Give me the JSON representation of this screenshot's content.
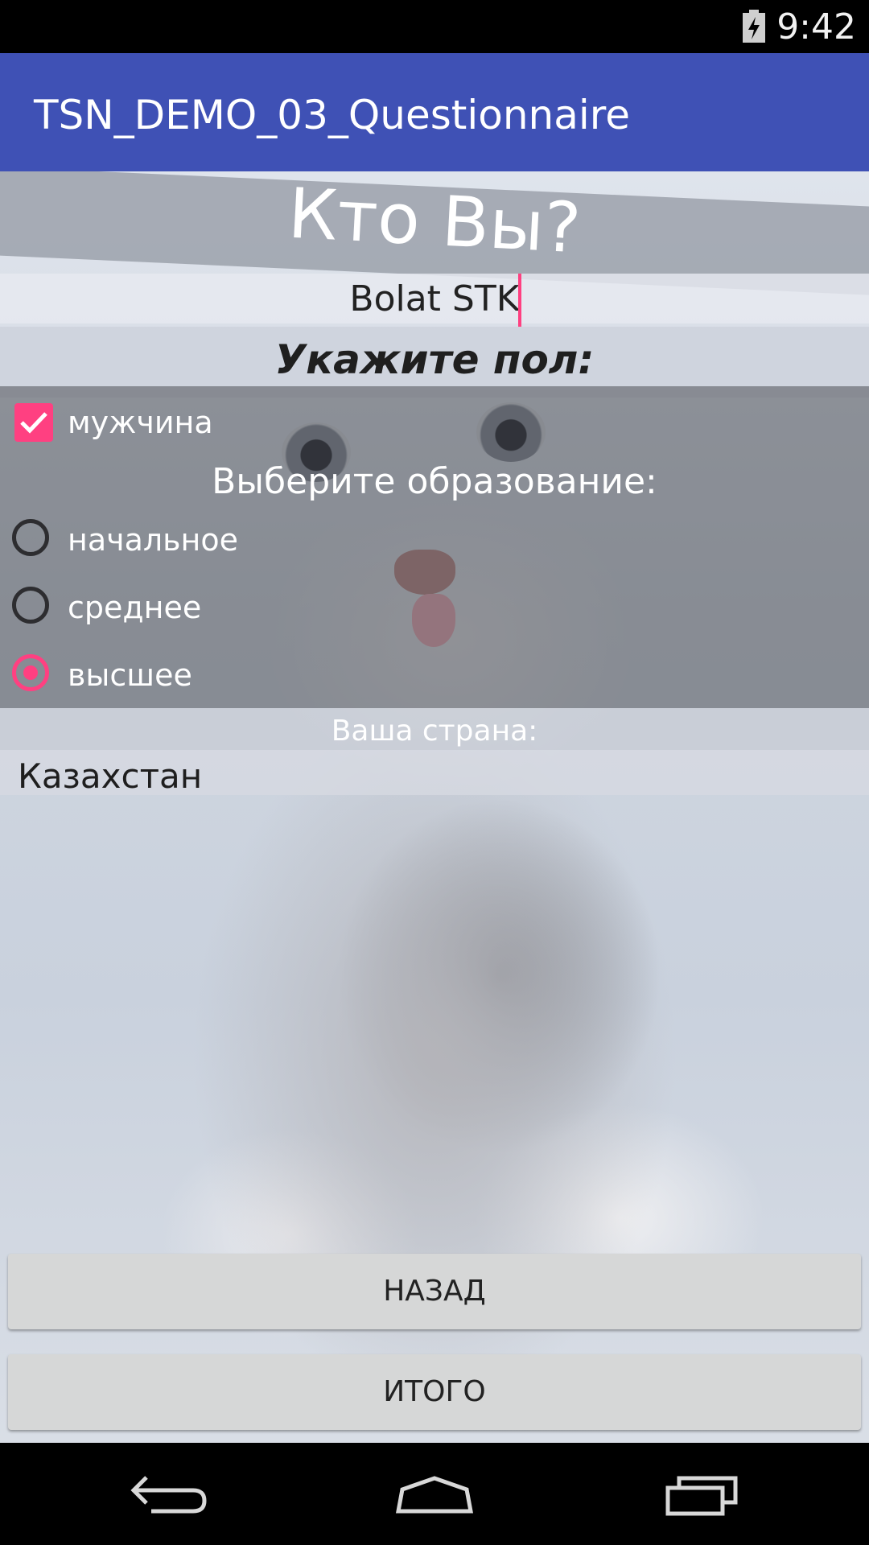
{
  "status_bar": {
    "time": "9:42",
    "battery_icon": "battery-charging-icon"
  },
  "app_bar": {
    "title": "TSN_DEMO_03_Questionnaire"
  },
  "form": {
    "heading": "Кто Вы?",
    "name_value": "Bolat STK",
    "gender_label": "Укажите пол:",
    "gender_checkbox": {
      "label": "мужчина",
      "checked": true
    },
    "education_label": "Выберите образование:",
    "education_options": [
      {
        "label": "начальное",
        "selected": false
      },
      {
        "label": "среднее",
        "selected": false
      },
      {
        "label": "высшее",
        "selected": true
      }
    ],
    "country_label": "Ваша страна:",
    "country_value": "Казахстан"
  },
  "buttons": {
    "back": "НАЗАД",
    "total": "ИТОГО"
  },
  "nav_bar": {
    "back_icon": "back-icon",
    "home_icon": "home-icon",
    "recents_icon": "recents-icon"
  },
  "colors": {
    "app_bar": "#3f51b5",
    "accent": "#ff4081"
  }
}
